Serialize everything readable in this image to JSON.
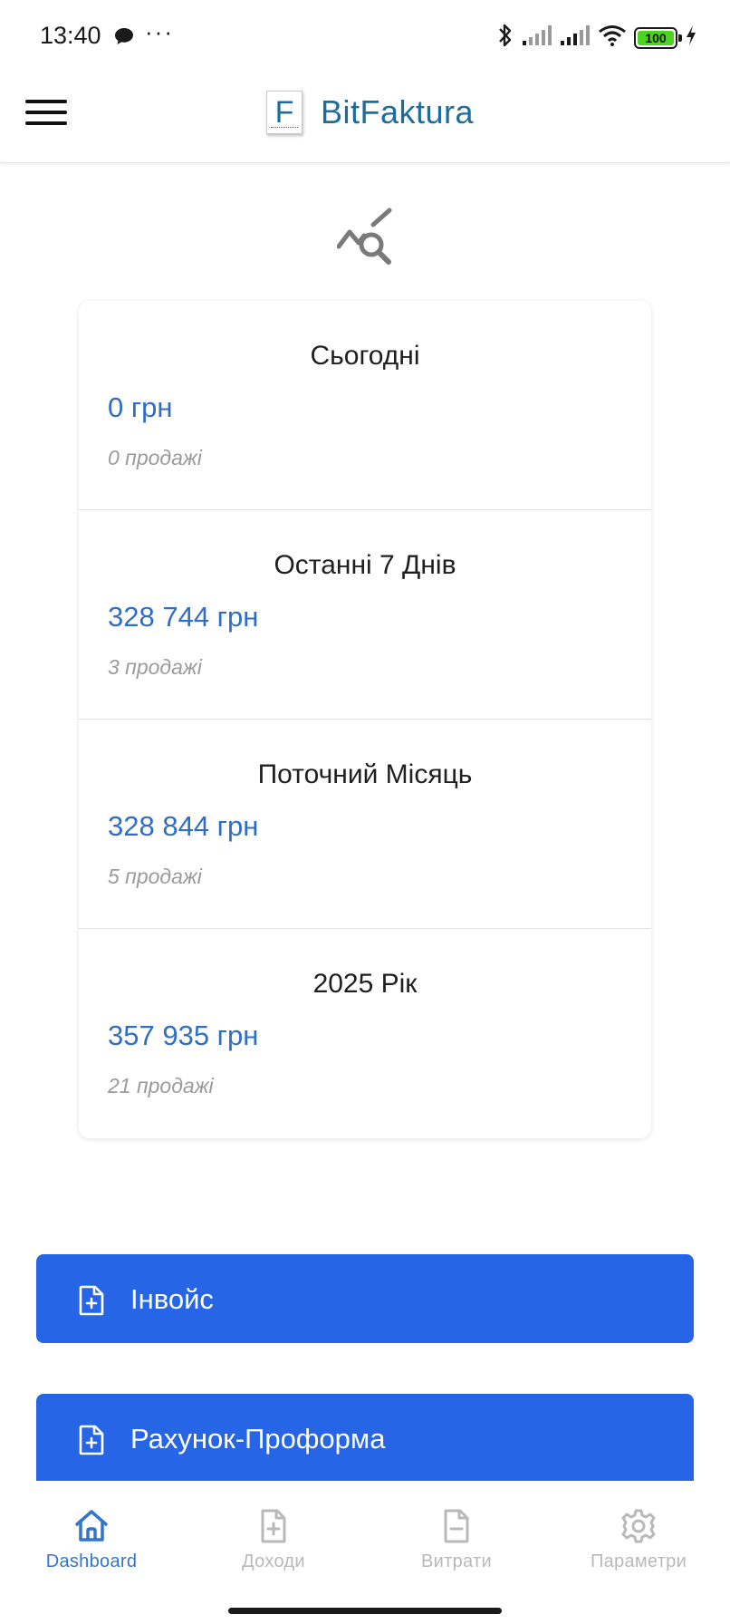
{
  "status_bar": {
    "time": "13:40",
    "dots": "···",
    "battery_level": "100",
    "icons": [
      "chat-bubble-icon",
      "bluetooth-icon",
      "signal-icon",
      "signal-icon",
      "wifi-icon",
      "battery-icon",
      "charging-icon"
    ]
  },
  "app_bar": {
    "logo_letter": "F",
    "brand_name": "BitFaktura",
    "menu_icon": "hamburger-menu-icon"
  },
  "dashboard": {
    "header_icon": "analytics-search-icon",
    "stats": [
      {
        "title": "Сьогодні",
        "amount": "0 грн",
        "count": "0 продажі"
      },
      {
        "title": "Останні 7 Днів",
        "amount": "328 744 грн",
        "count": "3 продажі"
      },
      {
        "title": "Поточний Місяць",
        "amount": "328 844 грн",
        "count": "5 продажі"
      },
      {
        "title": "2025 Рік",
        "amount": "357 935 грн",
        "count": "21 продажі"
      }
    ],
    "actions": [
      {
        "label": "Інвойс",
        "icon": "document-plus-icon"
      },
      {
        "label": "Рахунок-Проформа",
        "icon": "document-plus-icon"
      }
    ]
  },
  "bottom_nav": {
    "items": [
      {
        "label": "Dashboard",
        "icon": "home-icon",
        "active": true
      },
      {
        "label": "Доходи",
        "icon": "document-plus-icon",
        "active": false
      },
      {
        "label": "Витрати",
        "icon": "document-minus-icon",
        "active": false
      },
      {
        "label": "Параметри",
        "icon": "gear-icon",
        "active": false
      }
    ]
  },
  "colors": {
    "accent": "#2666e6",
    "amount_blue": "#2f6ec4",
    "brand_blue": "#1c6d9c",
    "nav_active": "#3475cc",
    "nav_inactive": "#b9b9b9"
  }
}
